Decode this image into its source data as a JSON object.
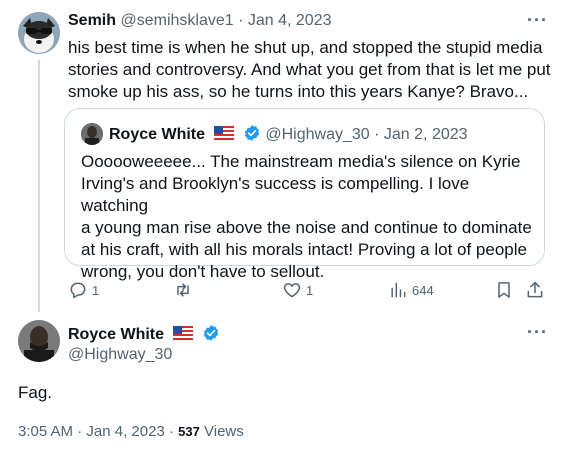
{
  "reply_tweet": {
    "display_name": "Semih",
    "handle": "@semihsklave1",
    "separator": "·",
    "date": "Jan 4, 2023",
    "more_label": "···",
    "text_lines": [
      "his best time is when he shut up, and stopped the stupid media",
      "stories and controversy. And what you get from that is let me put",
      "smoke up his ass, so he turns into this years Kanye? Bravo..."
    ],
    "quoted": {
      "display_name": "Royce White",
      "handle": "@Highway_30",
      "separator": "·",
      "date": "Jan 2, 2023",
      "text_lines": [
        "Oooooweeeee... The mainstream media's silence on Kyrie",
        "Irving's and Brooklyn's success is compelling. I love watching",
        "a young man rise above the noise and continue to dominate",
        "at his craft, with all his morals intact! Proving a lot of people",
        "wrong, you don't have to sellout."
      ]
    },
    "actions": {
      "reply_count": "1",
      "retweet_count": "",
      "like_count": "1",
      "views_count": "644"
    }
  },
  "main_tweet": {
    "display_name": "Royce White",
    "handle": "@Highway_30",
    "more_label": "···",
    "text": "Fag.",
    "time": "3:05 AM",
    "separator": "·",
    "date": "Jan 4, 2023",
    "separator2": "·",
    "views_count": "537",
    "views_label": "Views"
  },
  "colors": {
    "text": "#0f1419",
    "secondary": "#536471",
    "border": "#cfd9de",
    "verified_blue": "#1d9bf0"
  }
}
